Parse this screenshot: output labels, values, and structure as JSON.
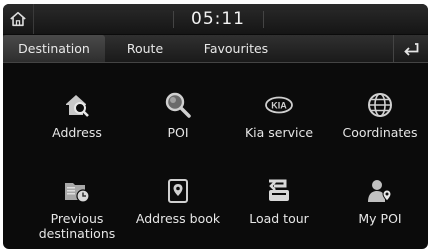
{
  "status": {
    "time": "05:11"
  },
  "tabs": [
    {
      "label": "Destination",
      "active": true
    },
    {
      "label": "Route",
      "active": false
    },
    {
      "label": "Favourites",
      "active": false
    }
  ],
  "menu": [
    {
      "label": "Address",
      "icon": "house-magnifier-icon"
    },
    {
      "label": "POI",
      "icon": "magnifier-icon"
    },
    {
      "label": "Kia service",
      "icon": "kia-logo-icon"
    },
    {
      "label": "Coordinates",
      "icon": "globe-icon"
    },
    {
      "label": "Previous destinations",
      "icon": "history-folder-icon"
    },
    {
      "label": "Address book",
      "icon": "address-book-icon"
    },
    {
      "label": "Load tour",
      "icon": "load-tour-icon"
    },
    {
      "label": "My POI",
      "icon": "my-poi-icon"
    }
  ],
  "colors": {
    "screen_bg": "#0b0b0b",
    "text": "#e6e6e6",
    "icon": "#c8c8c8"
  }
}
